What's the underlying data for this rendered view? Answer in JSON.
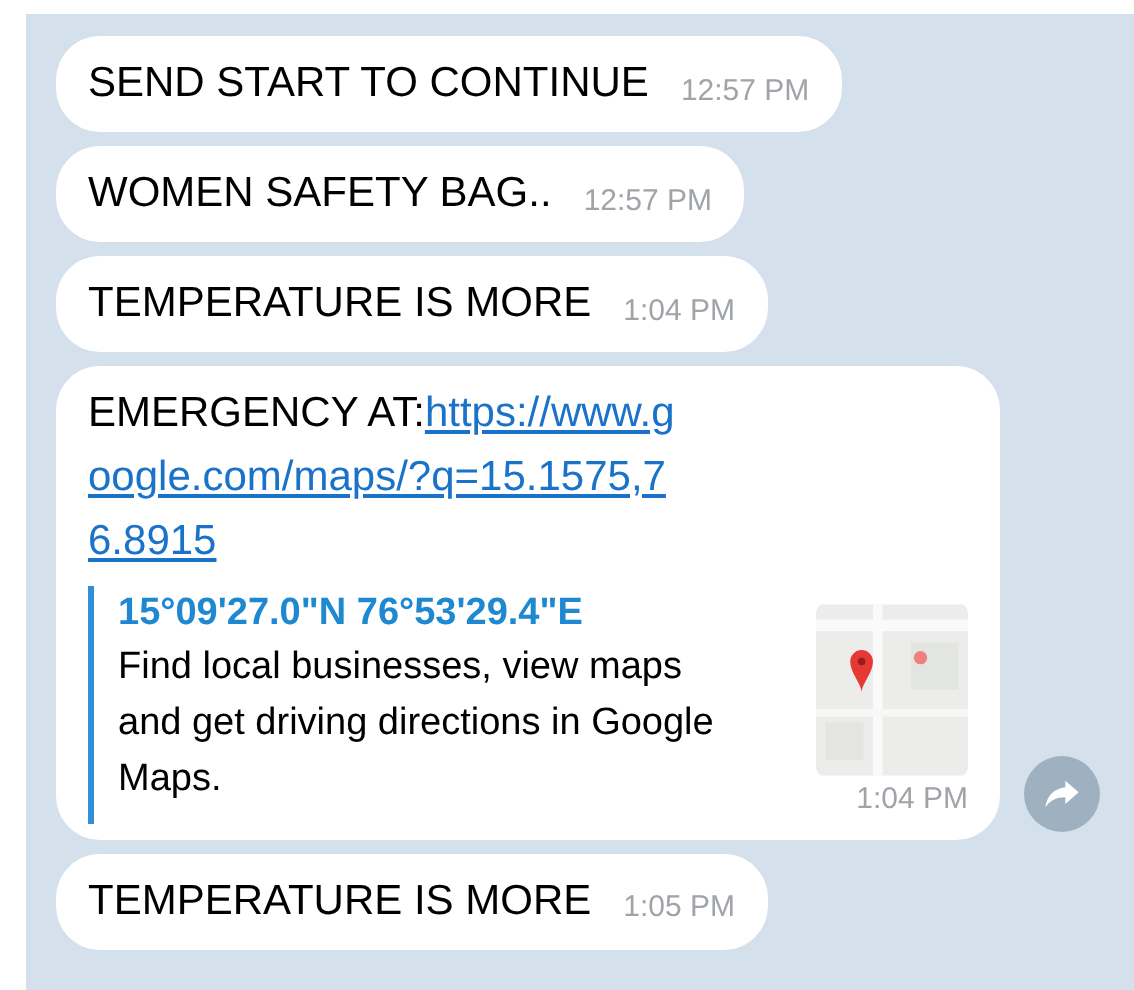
{
  "messages": [
    {
      "kind": "text",
      "text": "SEND START TO CONTINUE",
      "time": "12:57 PM",
      "forward": false
    },
    {
      "kind": "text",
      "text": "WOMEN SAFETY BAG..",
      "time": "12:57 PM",
      "forward": false
    },
    {
      "kind": "text",
      "text": "TEMPERATURE IS MORE",
      "time": "1:04 PM",
      "forward": false
    },
    {
      "kind": "link",
      "text": "EMERGENCY AT:",
      "link": "https://www.google.com/maps/?q=15.1575,76.8915",
      "preview": {
        "title": "15°09'27.0\"N 76°53'29.4\"E",
        "description": "Find local businesses, view maps and get driving directions in Google Maps."
      },
      "time": "1:04 PM",
      "forward": true
    },
    {
      "kind": "text",
      "text": "TEMPERATURE IS MORE",
      "time": "1:05 PM",
      "forward": false
    }
  ]
}
